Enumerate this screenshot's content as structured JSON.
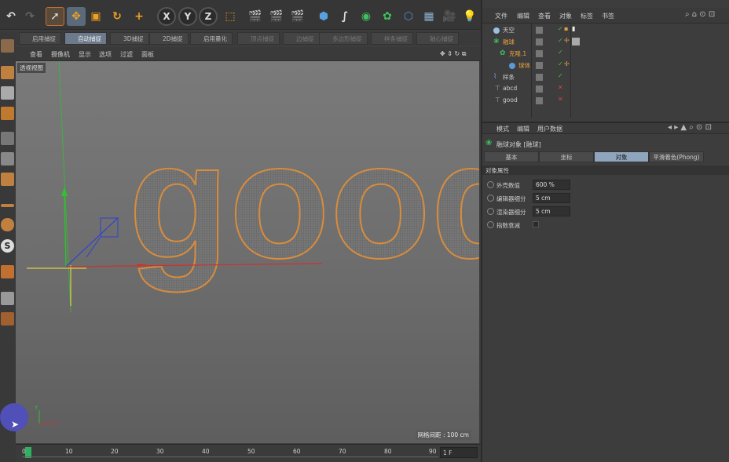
{
  "toolbar": {
    "undo_icon": "undo-icon",
    "axis_x": "X",
    "axis_y": "Y",
    "axis_z": "Z"
  },
  "snapbar": {
    "items": [
      "启用捕捉",
      "自动捕捉",
      "3D捕捉",
      "2D捕捉",
      "启用量化",
      "顶点捕捉",
      "边捕捉",
      "多边形捕捉",
      "样条捕捉",
      "轴心捕捉"
    ]
  },
  "viewmenu": {
    "items": [
      "查看",
      "摄像机",
      "显示",
      "选项",
      "过滤",
      "面板"
    ]
  },
  "viewport": {
    "label": "透视视图",
    "scene_text": "good",
    "grid_info": "网格间距 : 100 cm",
    "axis_x": "X",
    "axis_y": "Y"
  },
  "timeline": {
    "ticks": [
      "0",
      "10",
      "20",
      "30",
      "40",
      "50",
      "60",
      "70",
      "80",
      "90"
    ],
    "frame": "1 F"
  },
  "right_menu": {
    "items": [
      "文件",
      "编辑",
      "查看",
      "对象",
      "标签",
      "书签"
    ]
  },
  "objects": [
    {
      "name": "天空",
      "color": "#d0d0d0",
      "checks": [
        "green"
      ]
    },
    {
      "name": "融球",
      "color": "#e8a040",
      "checks": [
        "green"
      ]
    },
    {
      "name": "克隆.1",
      "color": "#e8a040",
      "checks": [
        "green"
      ]
    },
    {
      "name": "球体",
      "color": "#e8a040",
      "checks": [
        "green"
      ]
    },
    {
      "name": "样条",
      "color": "#d0d0d0",
      "checks": [
        "green"
      ]
    },
    {
      "name": "abcd",
      "color": "#d0d0d0",
      "checks": [
        "red"
      ]
    },
    {
      "name": "good",
      "color": "#d0d0d0",
      "checks": [
        "red"
      ]
    }
  ],
  "attr_menu": {
    "items": [
      "模式",
      "编辑",
      "用户数据"
    ]
  },
  "attr": {
    "title": "融球对象 [融球]",
    "tabs": [
      "基本",
      "坐标",
      "对象",
      "平滑着色(Phong)"
    ],
    "active_tab": 2,
    "section": "对象属性",
    "fields": [
      {
        "label": "外壳数值",
        "value": "600 %"
      },
      {
        "label": "编辑器细分",
        "value": "5 cm"
      },
      {
        "label": "渲染器细分",
        "value": "5 cm"
      },
      {
        "label": "指数衰减",
        "value": ""
      }
    ]
  }
}
